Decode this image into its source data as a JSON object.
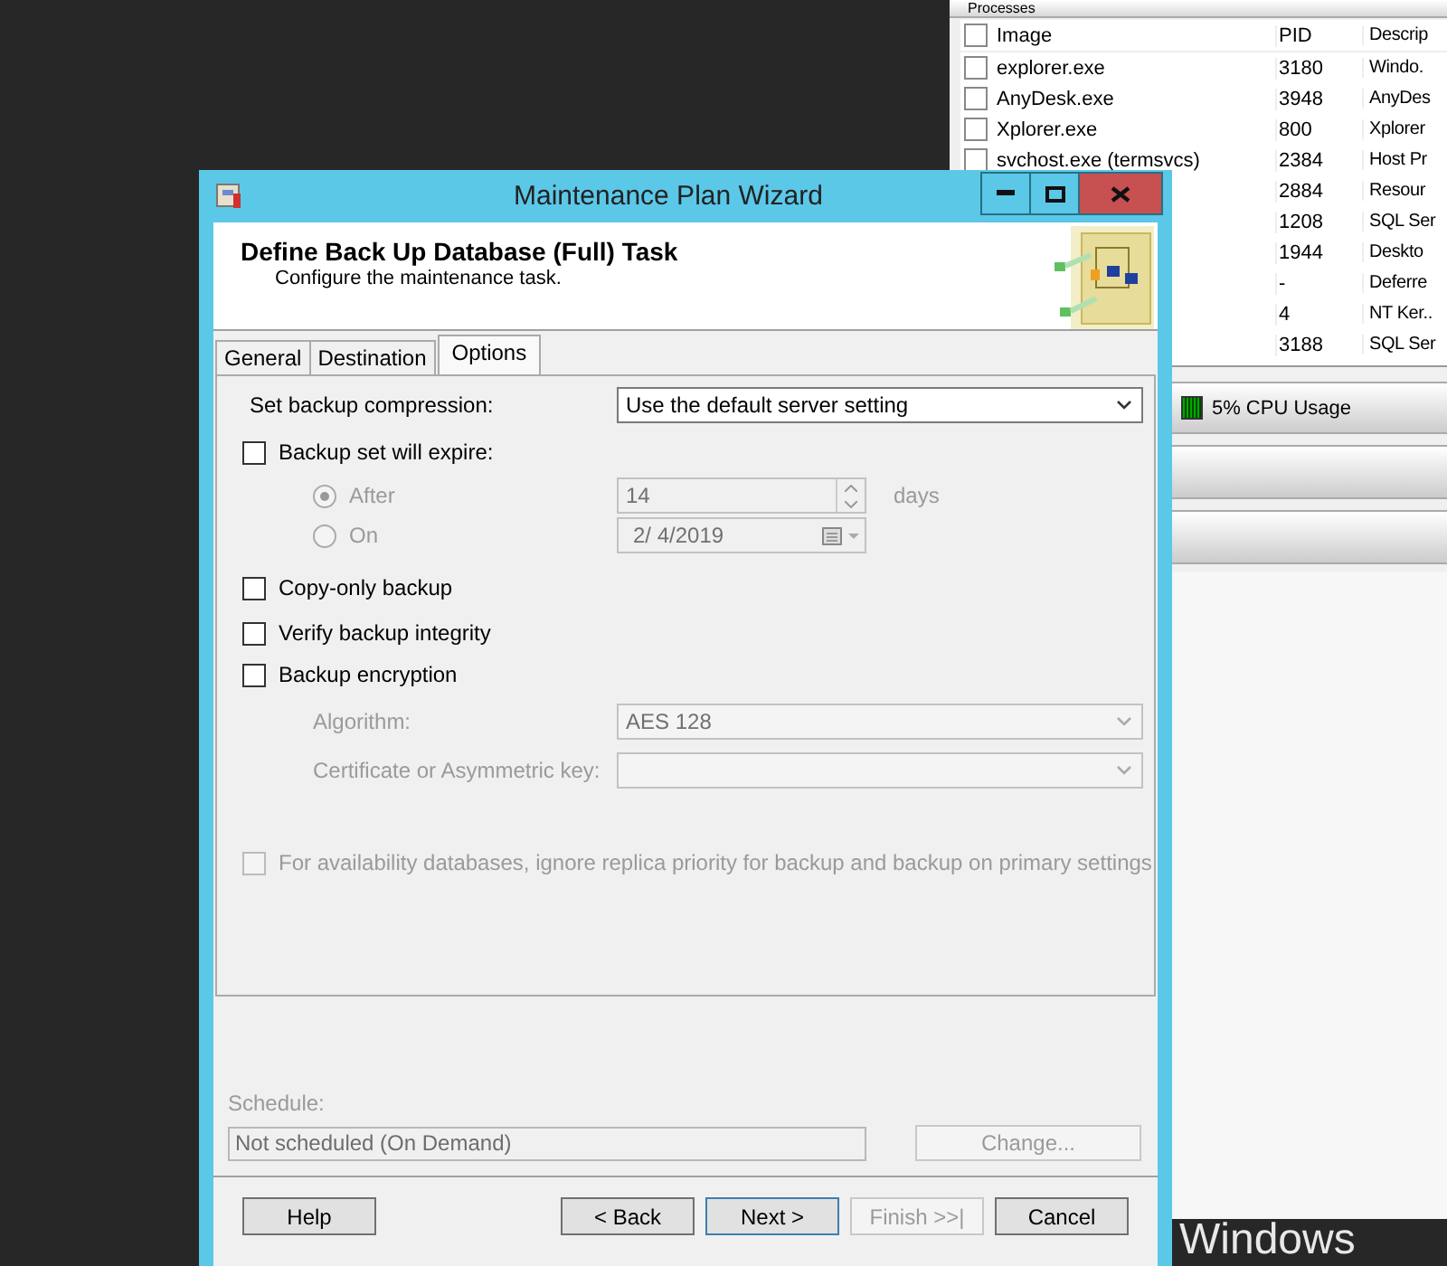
{
  "background_window": {
    "header": "Processes",
    "columns": [
      "Image",
      "PID",
      "Descrip"
    ],
    "all_checked": false,
    "rows": [
      {
        "image": "explorer.exe",
        "pid": "3180",
        "description": "Windo.",
        "checked": false
      },
      {
        "image": "AnyDesk.exe",
        "pid": "3948",
        "description": "AnyDes",
        "checked": false
      },
      {
        "image": "Xplorer.exe",
        "pid": "800",
        "description": "Xplorer",
        "checked": false
      },
      {
        "image": "svchost.exe (termsvcs)",
        "pid": "2384",
        "description": "Host Pr",
        "checked": false
      },
      {
        "pid": "2884",
        "description": "Resour"
      },
      {
        "pid": "1208",
        "description": "SQL Ser"
      },
      {
        "pid": "1944",
        "description": "Deskto"
      },
      {
        "pid": "-",
        "description": "Deferre"
      },
      {
        "pid": "4",
        "description": "NT Ker.."
      },
      {
        "pid": "3188",
        "description": "SQL Ser"
      }
    ],
    "cpu_usage": "5% CPU Usage"
  },
  "desktop_text": "Windows",
  "dialog": {
    "title": "Maintenance Plan Wizard",
    "header": {
      "title": "Define Back Up Database (Full) Task",
      "subtitle": "Configure the maintenance task."
    },
    "tabs": [
      {
        "label": "General",
        "selected": false
      },
      {
        "label": "Destination",
        "selected": false
      },
      {
        "label": "Options",
        "selected": true
      }
    ],
    "options": {
      "compression": {
        "label": "Set backup compression:",
        "value": "Use the default server setting"
      },
      "expire": {
        "label": "Backup set will expire:",
        "checked": false
      },
      "after": {
        "label": "After",
        "selected": true,
        "disabled": true,
        "value": "14",
        "unit": "days"
      },
      "on": {
        "label": "On",
        "selected": false,
        "disabled": true,
        "value": "2/ 4/2019"
      },
      "copy_only": {
        "label": "Copy-only backup",
        "checked": false
      },
      "verify": {
        "label": "Verify backup integrity",
        "checked": false
      },
      "encryption": {
        "label": "Backup encryption",
        "checked": false
      },
      "algorithm": {
        "label": "Algorithm:",
        "value": "AES 128",
        "disabled": true
      },
      "certificate": {
        "label": "Certificate or Asymmetric key:",
        "disabled": true
      },
      "availability": {
        "label": "For availability databases, ignore replica priority for backup and backup on primary settings",
        "checked": false,
        "disabled": true
      }
    },
    "schedule": {
      "label": "Schedule:",
      "value": "Not scheduled (On Demand)",
      "button": "Change...",
      "disabled": true
    },
    "buttons": [
      {
        "label": "Help",
        "disabled": false,
        "default": false
      },
      {
        "label": "< Back",
        "disabled": false,
        "default": false
      },
      {
        "label": "Next >",
        "disabled": false,
        "default": true
      },
      {
        "label": "Finish >>|",
        "disabled": true,
        "default": false
      },
      {
        "label": "Cancel",
        "disabled": false,
        "default": false
      }
    ]
  }
}
